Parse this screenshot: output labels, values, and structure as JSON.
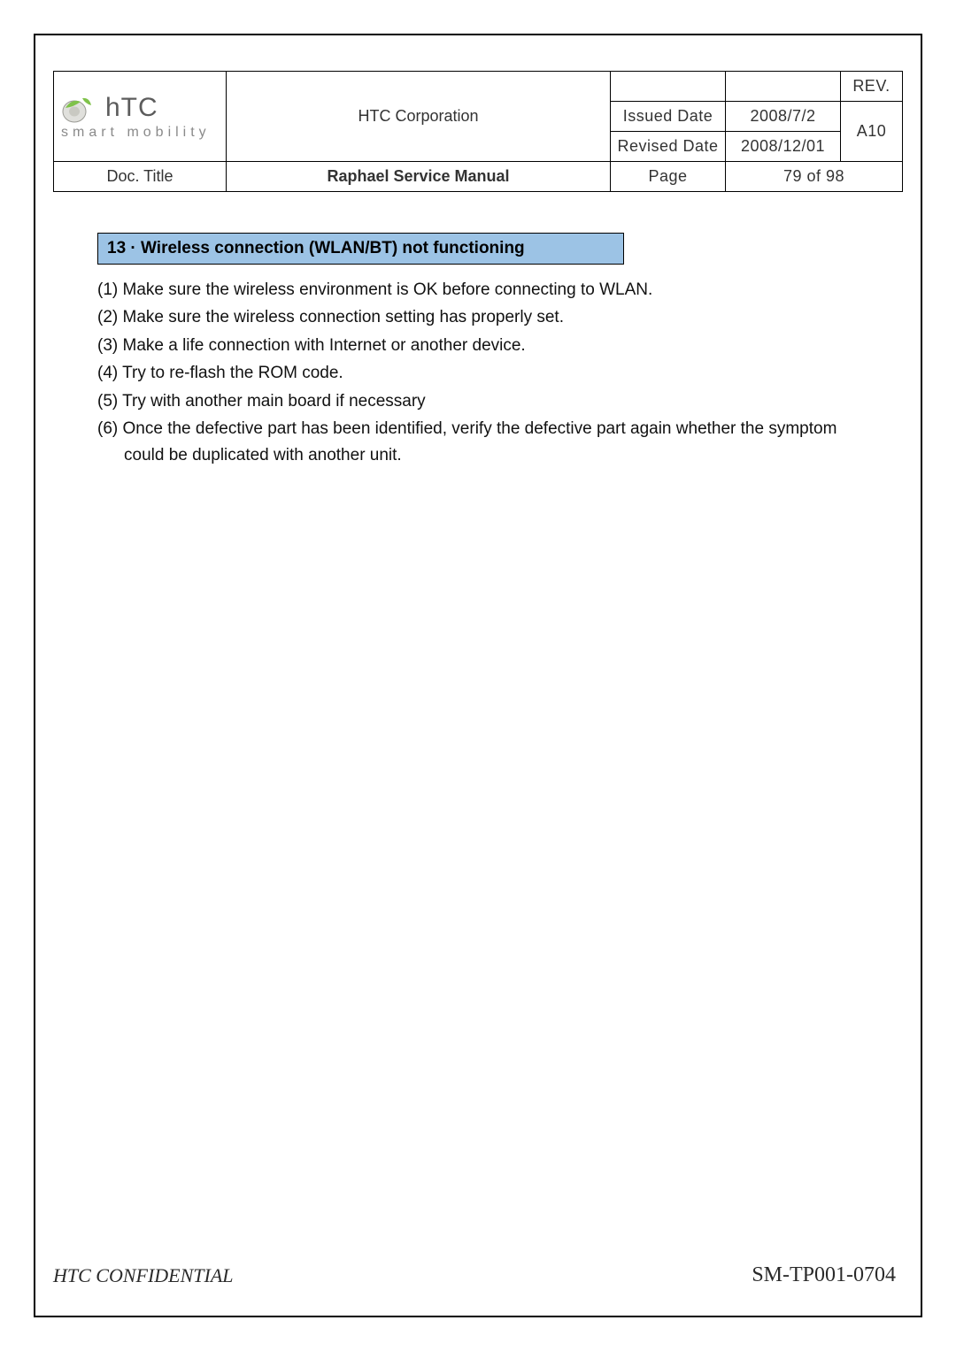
{
  "header": {
    "company": "HTC Corporation",
    "logo_text": "hTC",
    "logo_sub": "smart mobility",
    "rev_label": "REV.",
    "rev_value": "A10",
    "issued_label": "Issued Date",
    "issued_value": "2008/7/2",
    "revised_label": "Revised Date",
    "revised_value": "2008/12/01",
    "doc_title_label": "Doc. Title",
    "doc_title_value": "Raphael Service Manual",
    "page_label": "Page",
    "page_value": "79  of  98"
  },
  "section": {
    "title": "13  ·  Wireless connection (WLAN/BT) not functioning"
  },
  "steps": [
    "(1) Make sure the wireless environment is OK before connecting to WLAN.",
    "(2) Make sure the wireless connection setting has properly set.",
    "(3) Make a life connection with Internet or another device.",
    "(4) Try to re-flash the ROM code.",
    "(5) Try with another main board if necessary",
    "(6) Once the defective part has been identified, verify the defective part again whether the symptom could be duplicated with another unit."
  ],
  "footer": {
    "confidential": "HTC CONFIDENTIAL",
    "code": "SM-TP001-0704"
  }
}
